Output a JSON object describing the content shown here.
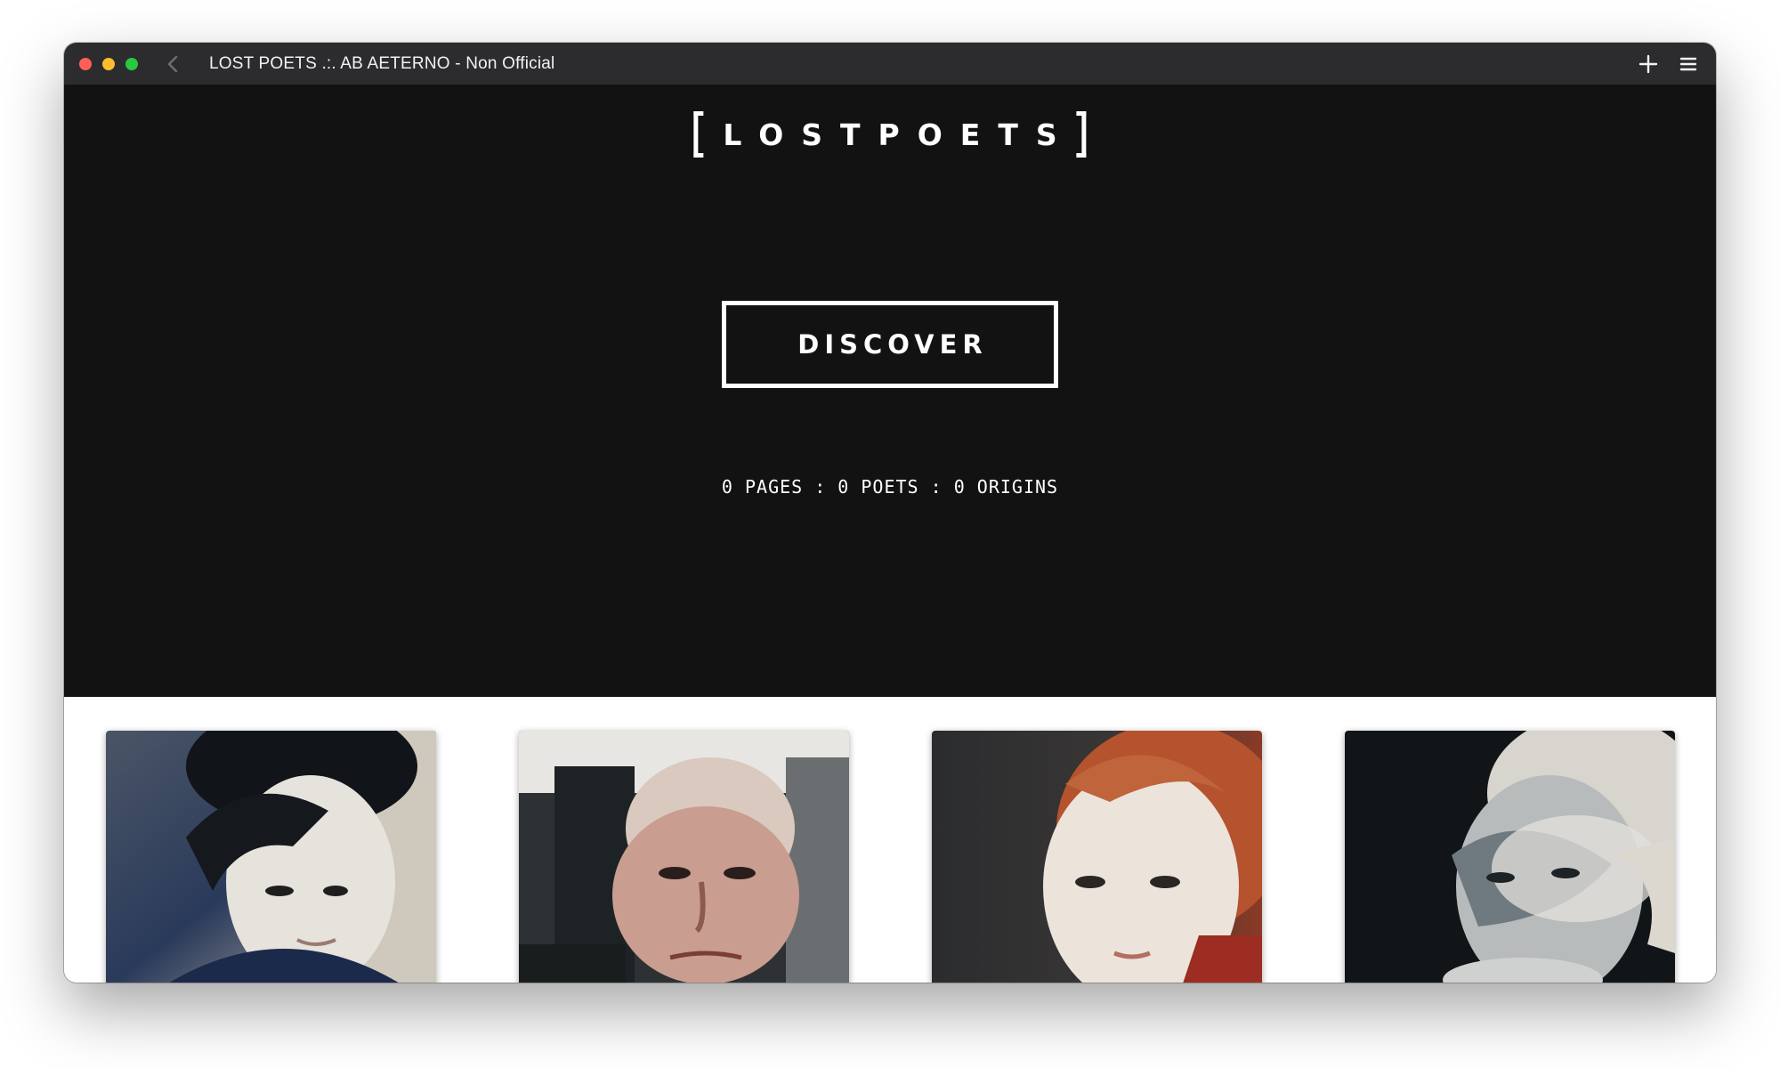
{
  "browser": {
    "tab_title": "LOST POETS .:. AB AETERNO - Non Official"
  },
  "hero": {
    "logo_text": "LOSTPOETS",
    "discover_label": "DISCOVER",
    "stats": "0 PAGES : 0 POETS : 0 ORIGINS"
  },
  "icons": {
    "back": "chevron-left-icon",
    "new_tab": "plus-icon",
    "menu": "hamburger-menu-icon"
  },
  "colors": {
    "hero_bg": "#121213",
    "titlebar_bg": "#2c2c2e",
    "accent": "#ffffff"
  }
}
